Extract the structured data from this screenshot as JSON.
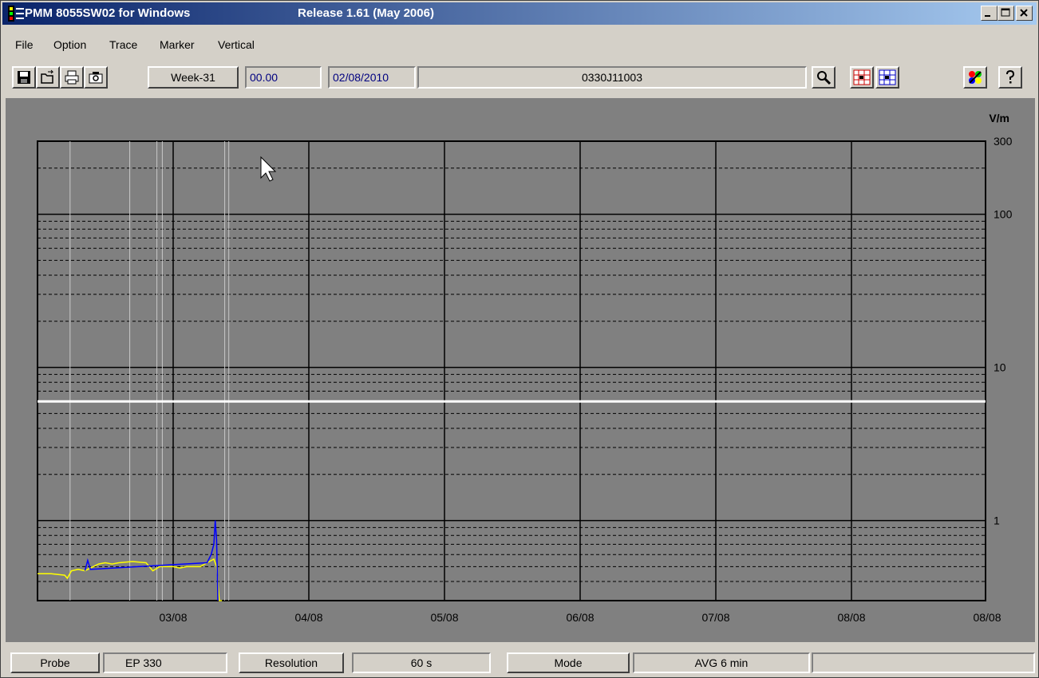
{
  "window": {
    "title": "PMM 8055SW02 for Windows",
    "release": "Release 1.61 (May 2006)",
    "controls": [
      "minimize-icon",
      "maximize-icon",
      "close-icon"
    ]
  },
  "menu": {
    "items": [
      "File",
      "Option",
      "Trace",
      "Marker",
      "Vertical"
    ]
  },
  "toolbar": {
    "buttons_left": [
      "save-icon",
      "open-icon",
      "print-icon",
      "camera-icon"
    ],
    "week": "Week-31",
    "time": "00.00",
    "date": "02/08/2010",
    "serial": "0330J11003",
    "buttons_right": [
      "zoom-icon",
      "grid-red-icon",
      "grid-blue-icon",
      "color-palette-icon",
      "help-icon"
    ]
  },
  "chart_data": {
    "type": "line",
    "unit_label": "V/m",
    "y_scale": "log",
    "ylim": [
      0.3,
      300
    ],
    "y_tick_labels": [
      "300",
      "100",
      "10",
      "1"
    ],
    "x_tick_labels": [
      "03/08",
      "04/08",
      "05/08",
      "06/08",
      "07/08",
      "08/08",
      "08/08"
    ],
    "limit_line_value": 6,
    "background": "#808080",
    "series": [
      {
        "color": "#ffff00",
        "x_days": [
          0,
          0.1,
          0.2,
          0.22,
          0.25,
          0.3,
          0.35,
          0.45,
          0.5,
          0.55,
          0.6,
          0.7,
          0.8,
          0.85,
          0.9,
          1.0,
          1.05,
          1.1,
          1.2,
          1.25,
          1.3,
          1.32,
          1.34,
          1.36
        ],
        "values": [
          0.45,
          0.45,
          0.44,
          0.42,
          0.47,
          0.48,
          0.47,
          0.52,
          0.53,
          0.52,
          0.53,
          0.54,
          0.53,
          0.47,
          0.5,
          0.5,
          0.49,
          0.5,
          0.5,
          0.53,
          0.56,
          0.5,
          0.3,
          0.3
        ]
      },
      {
        "color": "#0000ff",
        "x_days": [
          0.35,
          0.37,
          0.39,
          1.25,
          1.28,
          1.3,
          1.31,
          1.32,
          1.33
        ],
        "values": [
          0.47,
          0.55,
          0.48,
          0.53,
          0.6,
          0.7,
          1.0,
          0.75,
          0.3
        ]
      }
    ]
  },
  "status": {
    "probe_label": "Probe",
    "probe_value": "EP 330",
    "resolution_label": "Resolution",
    "resolution_value": "60 s",
    "mode_label": "Mode",
    "mode_value": "AVG  6 min"
  }
}
